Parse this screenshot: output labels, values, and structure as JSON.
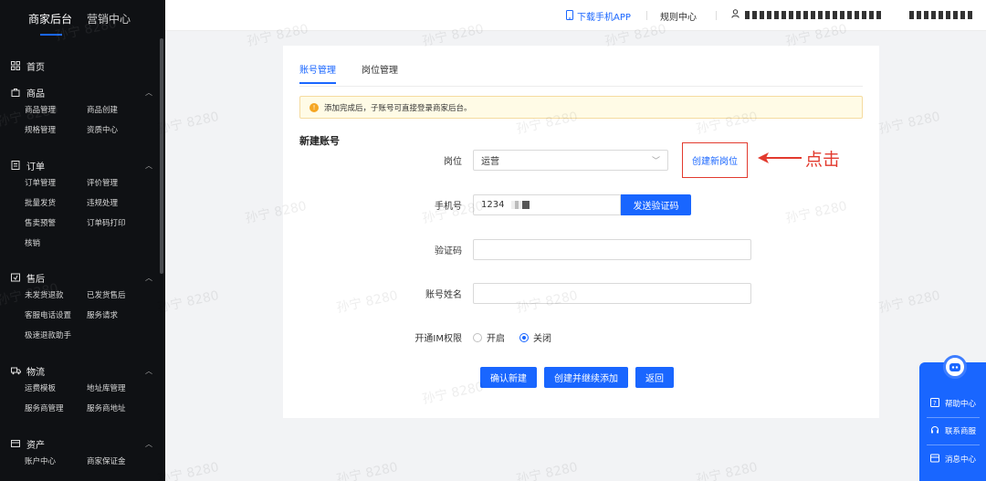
{
  "sidebar": {
    "header_active": "商家后台",
    "header_other": "营销中心",
    "home": "首页",
    "sections": [
      {
        "title": "商品",
        "icon": "bag-icon",
        "items": [
          "商品管理",
          "商品创建",
          "规格管理",
          "资质中心"
        ]
      },
      {
        "title": "订单",
        "icon": "order-icon",
        "items": [
          "订单管理",
          "评价管理",
          "批量发货",
          "违规处理",
          "售卖预警",
          "订单码打印",
          "核销"
        ]
      },
      {
        "title": "售后",
        "icon": "aftersale-icon",
        "items": [
          "未发货退款",
          "已发货售后",
          "客服电话设置",
          "服务请求",
          "极速退款助手"
        ]
      },
      {
        "title": "物流",
        "icon": "truck-icon",
        "items": [
          "运费模板",
          "地址库管理",
          "服务商管理",
          "服务商地址"
        ]
      },
      {
        "title": "资产",
        "icon": "asset-icon",
        "items": [
          "账户中心",
          "商家保证金"
        ]
      }
    ]
  },
  "topbar": {
    "download_app": "下载手机APP",
    "rules_center": "规则中心"
  },
  "tabs": [
    "账号管理",
    "岗位管理"
  ],
  "notice": "添加完成后，子账号可直接登录商家后台。",
  "section_title": "新建账号",
  "form": {
    "position_label": "岗位",
    "position_value": "运营",
    "create_position_link": "创建新岗位",
    "phone_label": "手机号",
    "phone_value": "1234",
    "send_code_button": "发送验证码",
    "code_label": "验证码",
    "name_label": "账号姓名",
    "im_label": "开通IM权限",
    "im_options": [
      "开启",
      "关闭"
    ],
    "im_selected": "关闭"
  },
  "buttons": {
    "confirm": "确认新建",
    "create_continue": "创建并继续添加",
    "back": "返回"
  },
  "annotation": "点击",
  "float_panel": {
    "items": [
      "帮助中心",
      "联系商服",
      "消息中心"
    ]
  },
  "watermark": "孙宁 8280",
  "colors": {
    "accent": "#1966ff",
    "annotation": "#e23a2e",
    "sidebar_bg": "#0f1114",
    "notice_bg": "#fffbe6"
  }
}
